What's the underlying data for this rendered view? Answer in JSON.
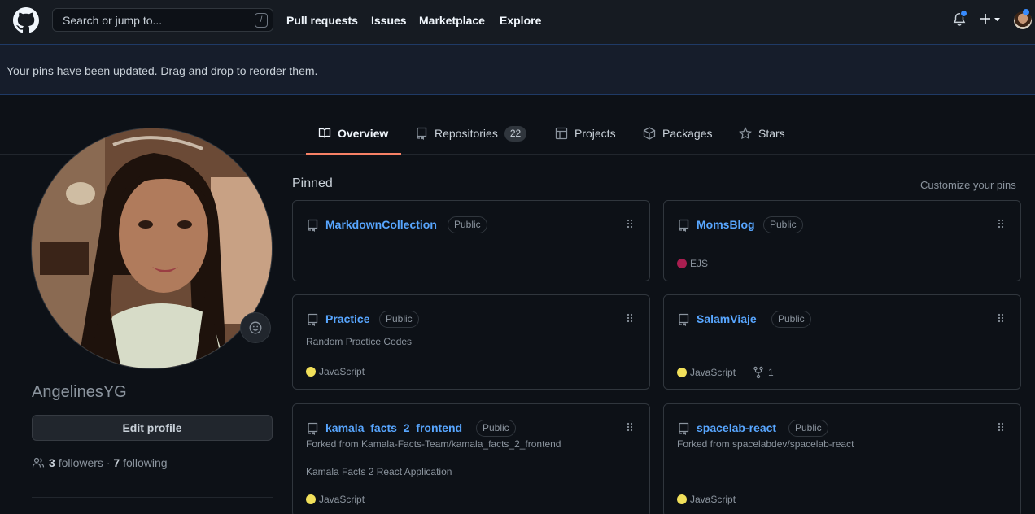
{
  "header": {
    "search_placeholder": "Search or jump to...",
    "search_key": "/",
    "nav": [
      "Pull requests",
      "Issues",
      "Marketplace",
      "Explore"
    ]
  },
  "flash": {
    "message": "Your pins have been updated. Drag and drop to reorder them."
  },
  "tabs": {
    "overview": "Overview",
    "repositories": "Repositories",
    "repositories_count": "22",
    "projects": "Projects",
    "packages": "Packages",
    "stars": "Stars"
  },
  "profile": {
    "username": "AngelinesYG",
    "edit_label": "Edit profile",
    "followers_count": "3",
    "followers_label": "followers",
    "separator": "·",
    "following_count": "7",
    "following_label": "following"
  },
  "pinned": {
    "title": "Pinned",
    "customize": "Customize your pins",
    "cards": [
      {
        "name": "MarkdownCollection",
        "visibility": "Public",
        "forked_from": "",
        "description": "",
        "language": "",
        "language_color": "",
        "forks": ""
      },
      {
        "name": "MomsBlog",
        "visibility": "Public",
        "forked_from": "",
        "description": "",
        "language": "EJS",
        "language_color": "#a91e50",
        "forks": ""
      },
      {
        "name": "Practice",
        "visibility": "Public",
        "forked_from": "",
        "description": "Random Practice Codes",
        "language": "JavaScript",
        "language_color": "#f1e05a",
        "forks": ""
      },
      {
        "name": "SalamViaje",
        "visibility": "Public",
        "forked_from": "",
        "description": "",
        "language": "JavaScript",
        "language_color": "#f1e05a",
        "forks": "1"
      },
      {
        "name": "kamala_facts_2_frontend",
        "visibility": "Public",
        "forked_from": "Forked from Kamala-Facts-Team/kamala_facts_2_frontend",
        "description": "Kamala Facts 2 React Application",
        "language": "JavaScript",
        "language_color": "#f1e05a",
        "forks": ""
      },
      {
        "name": "spacelab-react",
        "visibility": "Public",
        "forked_from": "Forked from spacelabdev/spacelab-react",
        "description": "",
        "language": "JavaScript",
        "language_color": "#f1e05a",
        "forks": ""
      }
    ]
  },
  "colors": {
    "accent": "#f78166",
    "link": "#58a6ff",
    "bg": "#0d1117"
  }
}
